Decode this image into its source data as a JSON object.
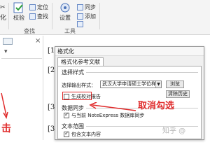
{
  "ribbon": {
    "cut_top": "✂",
    "cut_bottom": "化",
    "btn_verify": "校验",
    "btn_locate": "定位",
    "btn_find": "查找",
    "group_find": "查找",
    "btn_settings": "设置",
    "btn_sync": "同步",
    "btn_add": "添加",
    "btn_other": "",
    "group_tools": "工具"
  },
  "left_annotation": "击",
  "doc_refs": [
    "[1",
    "[2",
    "[3",
    "[3"
  ],
  "dialog": {
    "title": "格式化",
    "tab": "格式化参考文献",
    "section_style": "选择样式",
    "style_label": "选择输出样式：",
    "style_value": "武汉大学申请硕士学位样式",
    "browse_button": "浏览",
    "clear_history_button": "清除历史",
    "checkbox_report": "生成校对报告",
    "section_sync": "数据同步",
    "checkbox_sync": "与当前 NoteExpress 数据库同步",
    "section_text": "文本范围",
    "checkbox_text": "包含文本内容"
  },
  "annotation_right": "取消勾选",
  "watermark": "知乎 @"
}
